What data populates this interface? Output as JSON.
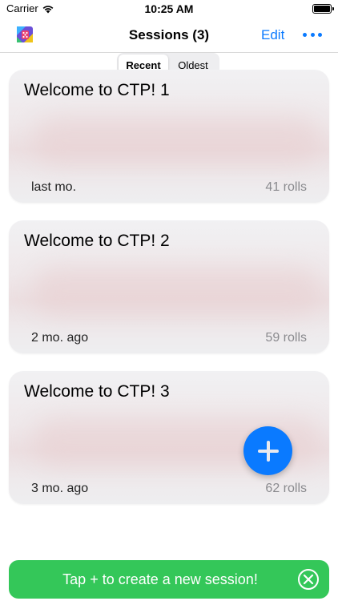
{
  "status_bar": {
    "carrier": "Carrier",
    "time": "10:25 AM"
  },
  "nav": {
    "title": "Sessions (3)",
    "edit_label": "Edit",
    "more_icon": "ellipsis-icon",
    "app_icon": "app-logo-icon"
  },
  "sort": {
    "options": [
      "Recent",
      "Oldest"
    ],
    "selected": "Recent"
  },
  "sessions": [
    {
      "title": "Welcome to CTP! 1",
      "date": "last mo.",
      "rolls": "41 rolls"
    },
    {
      "title": "Welcome to CTP! 2",
      "date": "2 mo. ago",
      "rolls": "59 rolls"
    },
    {
      "title": "Welcome to CTP! 3",
      "date": "3 mo. ago",
      "rolls": "62 rolls"
    }
  ],
  "fab": {
    "icon": "plus-icon",
    "color": "#0a7aff"
  },
  "toast": {
    "message": "Tap + to create a new session!",
    "close_icon": "close-circle-icon",
    "color": "#34c759"
  }
}
